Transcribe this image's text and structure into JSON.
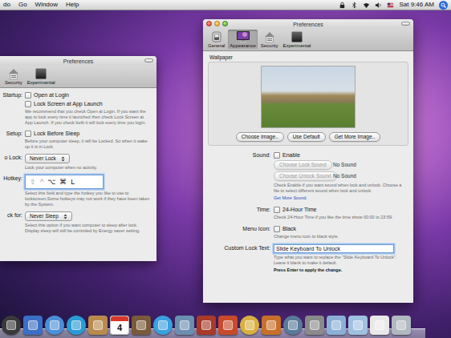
{
  "menu_bar": {
    "menus": [
      "do",
      "Go",
      "Window",
      "Help"
    ],
    "status_icons": [
      "lock",
      "bluetooth",
      "wifi",
      "volume",
      "flag"
    ],
    "clock": "Sat 9:46 AM"
  },
  "back_window": {
    "title": "Preferences",
    "tabs": [
      {
        "label": "Security",
        "kind": "security",
        "selected": false
      },
      {
        "label": "Experimental",
        "kind": "experimental",
        "selected": false
      }
    ],
    "rows": [
      {
        "label": "Startup:",
        "kind": "checks",
        "checks": [
          {
            "label": "Open at Login",
            "checked": false
          },
          {
            "label": "Lock Screen at App Launch",
            "checked": false
          }
        ],
        "note": "We recommend that you check Open at Login. If you want the app to lock every time it launched then check Lock Screen at App Launch. If you check both it will lock every time you login."
      },
      {
        "label": "Setup:",
        "kind": "checks",
        "checks": [
          {
            "label": "Lock Before Sleep",
            "checked": false
          }
        ],
        "note": "Before your computer sleep, it will be Locked. So when it wake up it is in Lock."
      },
      {
        "label": "o Lock:",
        "kind": "popup",
        "value": "Never Lock",
        "note": "Lock your computer when no activity."
      },
      {
        "label": "Hotkey:",
        "kind": "hotkey",
        "keys": [
          {
            "label": "⇧",
            "active": false
          },
          {
            "label": "^",
            "active": false
          },
          {
            "label": "⌥",
            "active": true
          },
          {
            "label": "⌘",
            "active": true
          },
          {
            "label": "L",
            "active": true
          }
        ],
        "note": "Select this field and type the hotkey you like to use to lockscreen.Some hotkeys may not work if they have been taken by the System."
      },
      {
        "label": "ck for:",
        "kind": "popup",
        "value": "Never Sleep",
        "note": "Select this option if you want computer to sleep after lock. Display sleep will still be controled by Energy saver setting."
      }
    ]
  },
  "front_window": {
    "title": "Preferences",
    "tabs": [
      {
        "label": "General",
        "kind": "general",
        "selected": false
      },
      {
        "label": "Appearance",
        "kind": "appearance",
        "selected": true
      },
      {
        "label": "Security",
        "kind": "security",
        "selected": false
      },
      {
        "label": "Experimental",
        "kind": "experimental",
        "selected": false
      }
    ],
    "wallpaper": {
      "label": "Wallpaper",
      "buttons": [
        "Choose Image..",
        "Use Default",
        "Get More Image.."
      ]
    },
    "rows": [
      {
        "label": "Sound:",
        "kind": "sound",
        "check": {
          "label": "Enable",
          "checked": false
        },
        "choosers": [
          {
            "button": "Choose Lock Sound",
            "disabled": true,
            "value": "No Sound"
          },
          {
            "button": "Choose Unlock Sound",
            "disabled": true,
            "value": "No Sound"
          }
        ],
        "note": "Check Enable if you want sound when lock and unlock. Choose a file to select different sound when lock and unlock.",
        "link": "Get More Sound."
      },
      {
        "label": "Time:",
        "kind": "check",
        "check": {
          "label": "24-Hour Time",
          "checked": false
        },
        "note": "Check 24-Hour Time if you like the time show 00:00 to 23:59."
      },
      {
        "label": "Menu Icon:",
        "kind": "check",
        "check": {
          "label": "Black",
          "checked": false
        },
        "note": "Change menu icon to black style."
      },
      {
        "label": "Custom Lock Text:",
        "kind": "text",
        "value": "Slide Keyboard To Unlock",
        "focused": true,
        "note": "Type what you want to replace the \"Slide Keyboard To Unlock\". Leave it blank to make it default.",
        "emphasis": "Press Enter to apply the change."
      }
    ]
  },
  "dock": {
    "items": [
      {
        "kind": "round",
        "color": "#3a3a3a"
      },
      {
        "kind": "square",
        "color": "#3b6fc4"
      },
      {
        "kind": "round",
        "color": "#4a8fd8"
      },
      {
        "kind": "round",
        "color": "#2a9bd6"
      },
      {
        "kind": "square",
        "color": "#b98a4e"
      },
      {
        "kind": "calendar",
        "color": "#ffffff",
        "label": "4"
      },
      {
        "kind": "square",
        "color": "#7a5a3a"
      },
      {
        "kind": "round",
        "color": "#3aa0e0"
      },
      {
        "kind": "square",
        "color": "#6a8fb0"
      },
      {
        "kind": "square",
        "color": "#a83a2a"
      },
      {
        "kind": "square",
        "color": "#c84a2a"
      },
      {
        "kind": "round",
        "color": "#d8b040"
      },
      {
        "kind": "square",
        "color": "#c8702a"
      },
      {
        "kind": "round",
        "color": "#5a7a9a"
      },
      {
        "kind": "square",
        "color": "#8a8a8a"
      },
      {
        "kind": "square",
        "color": "#8ab0d8"
      },
      {
        "kind": "square",
        "color": "#a0c0e0"
      },
      {
        "kind": "square",
        "color": "#e8e8e8"
      },
      {
        "kind": "square",
        "color": "#b0b8c0"
      }
    ]
  }
}
